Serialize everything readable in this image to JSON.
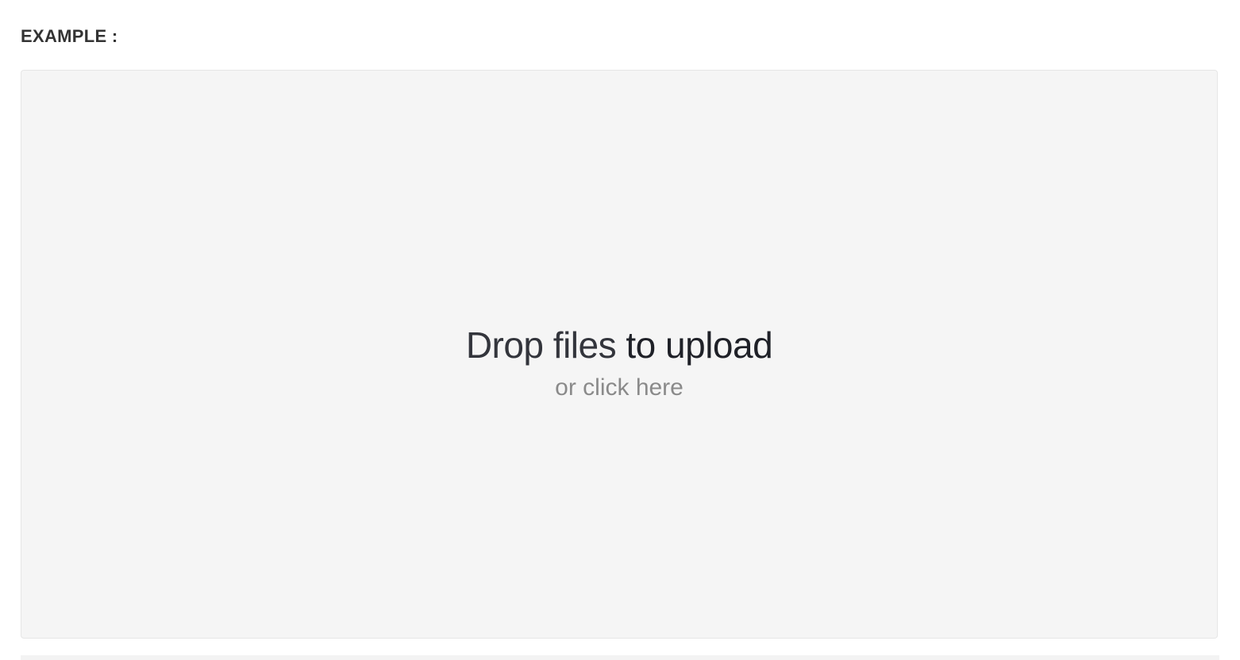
{
  "section": {
    "label": "EXAMPLE :"
  },
  "dropzone": {
    "message_part1": "Drop files",
    "message_part2": "to upload",
    "sub_message": "or click here",
    "background_color": "#f5f5f5"
  }
}
